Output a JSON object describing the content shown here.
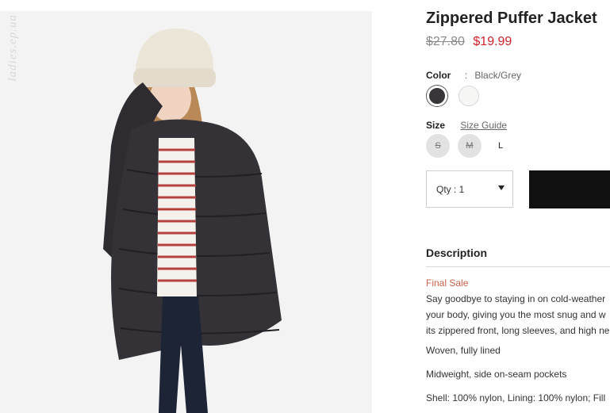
{
  "product": {
    "title": "Zippered Puffer Jacket",
    "price_old": "$27.80",
    "price_new": "$19.99"
  },
  "color": {
    "label": "Color",
    "separator": ":",
    "selected": "Black/Grey",
    "swatches": [
      {
        "name": "Black/Grey",
        "hex": "#38353b",
        "selected": true
      },
      {
        "name": "Cream",
        "hex": "#f6f6f4",
        "selected": false
      }
    ]
  },
  "size": {
    "label": "Size",
    "guide_label": "Size Guide",
    "options": [
      {
        "label": "S",
        "available": false
      },
      {
        "label": "M",
        "available": false
      },
      {
        "label": "L",
        "available": true
      }
    ]
  },
  "quantity": {
    "label": "Qty : 1"
  },
  "description": {
    "heading": "Description",
    "final_sale": "Final Sale",
    "lines": [
      "Say goodbye to staying in on cold-weather",
      "your body, giving you the most snug and w",
      "its zippered front, long sleeves, and high ne",
      "Woven, fully lined",
      "Midweight, side on-seam pockets",
      "Shell: 100% nylon, Lining: 100% nylon; Fill"
    ]
  },
  "watermark": "ladies.ep.ua",
  "colors": {
    "sale_price": "#d3232a",
    "final_sale": "#c8604a",
    "add_button": "#111111"
  }
}
